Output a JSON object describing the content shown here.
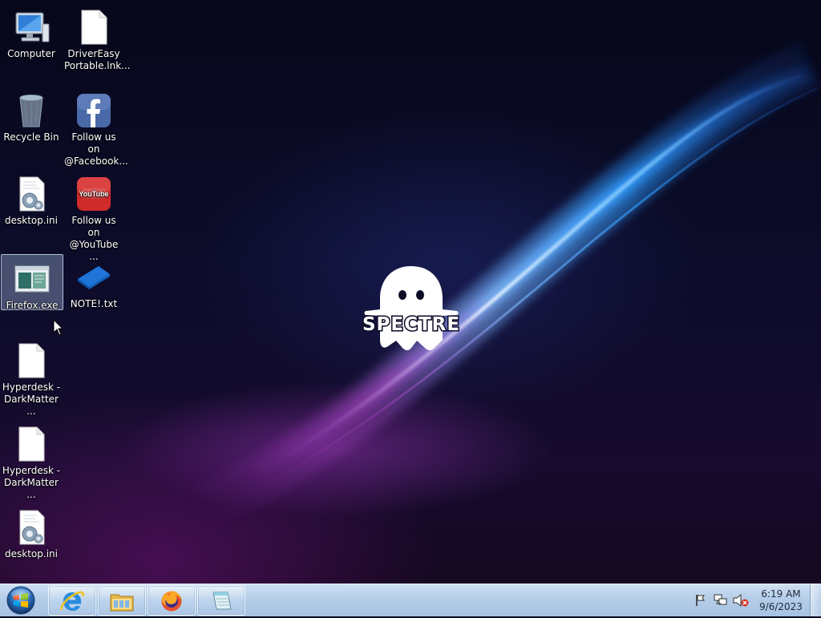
{
  "desktop": {
    "icons": [
      {
        "label": "Computer",
        "icon": "computer-icon"
      },
      {
        "label": "DriverEasy Portable.lnk...",
        "icon": "blank-file-icon"
      },
      {
        "label": "Recycle Bin",
        "icon": "recycle-bin-icon"
      },
      {
        "label": "Follow us on @Facebook...",
        "icon": "facebook-icon"
      },
      {
        "label": "desktop.ini",
        "icon": "config-file-icon"
      },
      {
        "label": "Follow us on @YouTube ...",
        "icon": "youtube-icon"
      },
      {
        "label": "Firefox.exe",
        "icon": "exe-window-icon"
      },
      {
        "label": "NOTE!.txt",
        "icon": "note-icon"
      },
      {
        "label": "Hyperdesk - DarkMatter ...",
        "icon": "blank-file-icon"
      },
      {
        "label": "Hyperdesk - DarkMatter ...",
        "icon": "blank-file-icon"
      },
      {
        "label": "desktop.ini",
        "icon": "config-file-icon"
      }
    ],
    "wallpaper_logo_text": "SPECTRE"
  },
  "taskbar": {
    "pinned": [
      {
        "name": "Internet Explorer",
        "icon": "internet-explorer-icon"
      },
      {
        "name": "File Explorer",
        "icon": "folder-icon"
      },
      {
        "name": "Firefox",
        "icon": "firefox-icon"
      },
      {
        "name": "Notepad",
        "icon": "notepad-icon"
      }
    ],
    "tray": {
      "icons": [
        "flag-icon",
        "network-icon",
        "volume-muted-icon"
      ],
      "time": "6:19 AM",
      "date": "9/6/2023"
    }
  },
  "colors": {
    "taskbar": "#b4cde8",
    "selection": "#b4cdf0",
    "streak": "#3fa8ff"
  }
}
